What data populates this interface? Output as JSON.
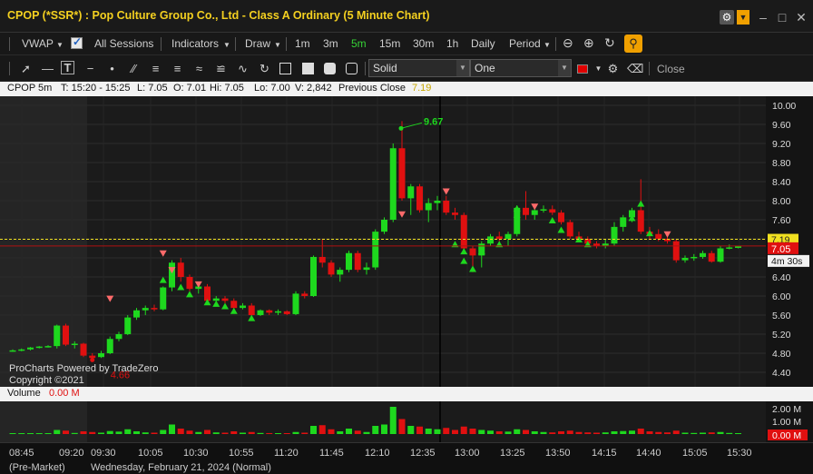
{
  "window": {
    "title": "CPOP (*SSR*) : Pop Culture Group Co., Ltd - Class A Ordinary (5 Minute Chart)"
  },
  "toolbar1": {
    "vwap": "VWAP",
    "all_sessions": "All Sessions",
    "indicators": "Indicators",
    "draw": "Draw",
    "intervals": [
      "1m",
      "3m",
      "5m",
      "15m",
      "30m",
      "1h",
      "Daily"
    ],
    "active_interval": "5m",
    "period": "Period"
  },
  "toolbar2": {
    "line_style": "Solid",
    "line_width": "One",
    "draw_color": "#e00000",
    "close": "Close"
  },
  "info": {
    "symbol": "CPOP 5m",
    "time": "T: 15:20 - 15:25",
    "last": "L: 7.05",
    "open": "O: 7.01",
    "high": "Hi: 7.05",
    "low": "Lo: 7.00",
    "volume": "V: 2,842",
    "prev_close_label": "Previous Close",
    "prev_close_value": "7.19"
  },
  "volume_panel": {
    "label": "Volume",
    "value": "0.00 M",
    "axis": [
      "2.00 M",
      "1.00 M",
      "0.00 M"
    ]
  },
  "watermark": {
    "line1": "ProCharts Powered by TradeZero",
    "line2": "Copyright ©2021"
  },
  "x_axis": {
    "ticks": [
      "08:45",
      "09:20",
      "09:30",
      "10:05",
      "10:30",
      "10:55",
      "11:20",
      "11:45",
      "12:10",
      "12:35",
      "13:00",
      "13:25",
      "13:50",
      "14:15",
      "14:40",
      "15:05",
      "15:30"
    ],
    "session": "(Pre-Market)",
    "date": "Wednesday, February 21, 2024 (Normal)"
  },
  "colors": {
    "up": "#1ed81e",
    "down": "#e01010",
    "prev_close_line": "#f0e020",
    "current_price_bg": "#e01010"
  },
  "chart_data": {
    "type": "candlestick",
    "ylim": [
      4.2,
      10.1
    ],
    "y_ticks": [
      "10.00",
      "9.60",
      "9.20",
      "8.80",
      "8.40",
      "8.00",
      "7.60",
      "7.20",
      "6.80",
      "6.40",
      "6.00",
      "5.60",
      "5.20",
      "4.80",
      "4.40"
    ],
    "previous_close": 7.19,
    "current_price": "7.05",
    "countdown": "4m 30s",
    "annotations": [
      {
        "label": "9.67",
        "value": 9.67
      },
      {
        "label": "4.66",
        "value": 4.66
      }
    ],
    "candles": [
      {
        "o": 4.85,
        "h": 4.88,
        "l": 4.83,
        "c": 4.86
      },
      {
        "o": 4.86,
        "h": 4.9,
        "l": 4.84,
        "c": 4.88
      },
      {
        "o": 4.88,
        "h": 4.93,
        "l": 4.86,
        "c": 4.92
      },
      {
        "o": 4.92,
        "h": 4.95,
        "l": 4.9,
        "c": 4.94
      },
      {
        "o": 4.94,
        "h": 4.97,
        "l": 4.92,
        "c": 4.95
      },
      {
        "o": 4.95,
        "h": 5.4,
        "l": 4.9,
        "c": 5.38
      },
      {
        "o": 5.38,
        "h": 5.42,
        "l": 4.95,
        "c": 4.98
      },
      {
        "o": 4.98,
        "h": 5.05,
        "l": 4.9,
        "c": 5.0
      },
      {
        "o": 5.0,
        "h": 5.02,
        "l": 4.72,
        "c": 4.75
      },
      {
        "o": 4.75,
        "h": 4.8,
        "l": 4.66,
        "c": 4.7
      },
      {
        "o": 4.72,
        "h": 4.85,
        "l": 4.7,
        "c": 4.8
      },
      {
        "o": 4.8,
        "h": 5.15,
        "l": 4.78,
        "c": 5.1
      },
      {
        "o": 5.1,
        "h": 5.25,
        "l": 5.05,
        "c": 5.2
      },
      {
        "o": 5.2,
        "h": 5.6,
        "l": 5.18,
        "c": 5.55
      },
      {
        "o": 5.55,
        "h": 5.75,
        "l": 5.5,
        "c": 5.7
      },
      {
        "o": 5.7,
        "h": 5.8,
        "l": 5.6,
        "c": 5.75
      },
      {
        "o": 5.75,
        "h": 5.82,
        "l": 5.68,
        "c": 5.72
      },
      {
        "o": 5.72,
        "h": 6.2,
        "l": 5.7,
        "c": 6.18
      },
      {
        "o": 6.18,
        "h": 6.75,
        "l": 6.1,
        "c": 6.7
      },
      {
        "o": 6.7,
        "h": 6.8,
        "l": 6.3,
        "c": 6.4
      },
      {
        "o": 6.4,
        "h": 6.45,
        "l": 6.1,
        "c": 6.15
      },
      {
        "o": 6.15,
        "h": 6.25,
        "l": 6.05,
        "c": 6.2
      },
      {
        "o": 6.2,
        "h": 6.25,
        "l": 5.85,
        "c": 5.9
      },
      {
        "o": 5.9,
        "h": 6.0,
        "l": 5.8,
        "c": 5.95
      },
      {
        "o": 5.95,
        "h": 6.0,
        "l": 5.85,
        "c": 5.9
      },
      {
        "o": 5.9,
        "h": 5.95,
        "l": 5.7,
        "c": 5.75
      },
      {
        "o": 5.75,
        "h": 5.85,
        "l": 5.72,
        "c": 5.8
      },
      {
        "o": 5.8,
        "h": 5.85,
        "l": 5.55,
        "c": 5.6
      },
      {
        "o": 5.6,
        "h": 5.72,
        "l": 5.58,
        "c": 5.7
      },
      {
        "o": 5.7,
        "h": 5.72,
        "l": 5.6,
        "c": 5.65
      },
      {
        "o": 5.65,
        "h": 5.72,
        "l": 5.6,
        "c": 5.68
      },
      {
        "o": 5.68,
        "h": 5.7,
        "l": 5.6,
        "c": 5.62
      },
      {
        "o": 5.62,
        "h": 6.1,
        "l": 5.6,
        "c": 6.05
      },
      {
        "o": 6.05,
        "h": 6.1,
        "l": 5.95,
        "c": 6.0
      },
      {
        "o": 6.0,
        "h": 6.85,
        "l": 5.98,
        "c": 6.82
      },
      {
        "o": 6.82,
        "h": 7.2,
        "l": 6.6,
        "c": 6.7
      },
      {
        "o": 6.7,
        "h": 6.75,
        "l": 6.4,
        "c": 6.45
      },
      {
        "o": 6.45,
        "h": 6.6,
        "l": 6.3,
        "c": 6.55
      },
      {
        "o": 6.55,
        "h": 6.95,
        "l": 6.5,
        "c": 6.9
      },
      {
        "o": 6.9,
        "h": 6.95,
        "l": 6.5,
        "c": 6.55
      },
      {
        "o": 6.55,
        "h": 6.7,
        "l": 6.45,
        "c": 6.6
      },
      {
        "o": 6.6,
        "h": 7.4,
        "l": 6.55,
        "c": 7.35
      },
      {
        "o": 7.35,
        "h": 7.65,
        "l": 7.3,
        "c": 7.6
      },
      {
        "o": 7.6,
        "h": 9.2,
        "l": 7.55,
        "c": 9.1
      },
      {
        "o": 9.1,
        "h": 9.67,
        "l": 8.0,
        "c": 8.05
      },
      {
        "o": 8.05,
        "h": 8.35,
        "l": 7.7,
        "c": 8.3
      },
      {
        "o": 8.3,
        "h": 8.35,
        "l": 7.75,
        "c": 7.8
      },
      {
        "o": 7.8,
        "h": 8.05,
        "l": 7.55,
        "c": 7.95
      },
      {
        "o": 7.95,
        "h": 8.1,
        "l": 7.8,
        "c": 8.0
      },
      {
        "o": 8.0,
        "h": 8.1,
        "l": 7.7,
        "c": 7.75
      },
      {
        "o": 7.75,
        "h": 7.85,
        "l": 7.6,
        "c": 7.7
      },
      {
        "o": 7.7,
        "h": 7.75,
        "l": 6.95,
        "c": 7.0
      },
      {
        "o": 7.0,
        "h": 7.05,
        "l": 6.5,
        "c": 6.85
      },
      {
        "o": 6.85,
        "h": 7.15,
        "l": 6.6,
        "c": 7.1
      },
      {
        "o": 7.1,
        "h": 7.3,
        "l": 7.05,
        "c": 7.25
      },
      {
        "o": 7.25,
        "h": 7.35,
        "l": 7.15,
        "c": 7.2
      },
      {
        "o": 7.2,
        "h": 7.35,
        "l": 7.05,
        "c": 7.3
      },
      {
        "o": 7.3,
        "h": 7.9,
        "l": 7.25,
        "c": 7.85
      },
      {
        "o": 7.85,
        "h": 8.2,
        "l": 7.6,
        "c": 7.7
      },
      {
        "o": 7.7,
        "h": 7.85,
        "l": 7.6,
        "c": 7.8
      },
      {
        "o": 7.8,
        "h": 7.9,
        "l": 7.75,
        "c": 7.82
      },
      {
        "o": 7.82,
        "h": 7.9,
        "l": 7.7,
        "c": 7.75
      },
      {
        "o": 7.75,
        "h": 7.8,
        "l": 7.5,
        "c": 7.55
      },
      {
        "o": 7.55,
        "h": 7.6,
        "l": 7.2,
        "c": 7.25
      },
      {
        "o": 7.25,
        "h": 7.35,
        "l": 7.15,
        "c": 7.2
      },
      {
        "o": 7.2,
        "h": 7.25,
        "l": 7.05,
        "c": 7.1
      },
      {
        "o": 7.1,
        "h": 7.15,
        "l": 7.0,
        "c": 7.05
      },
      {
        "o": 7.05,
        "h": 7.2,
        "l": 7.0,
        "c": 7.1
      },
      {
        "o": 7.1,
        "h": 7.55,
        "l": 7.05,
        "c": 7.45
      },
      {
        "o": 7.45,
        "h": 7.7,
        "l": 7.35,
        "c": 7.65
      },
      {
        "o": 7.65,
        "h": 7.85,
        "l": 7.55,
        "c": 7.8
      },
      {
        "o": 7.8,
        "h": 8.45,
        "l": 7.3,
        "c": 7.35
      },
      {
        "o": 7.35,
        "h": 7.45,
        "l": 7.2,
        "c": 7.3
      },
      {
        "o": 7.3,
        "h": 7.4,
        "l": 7.15,
        "c": 7.2
      },
      {
        "o": 7.2,
        "h": 7.25,
        "l": 7.1,
        "c": 7.15
      },
      {
        "o": 7.15,
        "h": 7.2,
        "l": 6.7,
        "c": 6.75
      },
      {
        "o": 6.75,
        "h": 6.85,
        "l": 6.7,
        "c": 6.8
      },
      {
        "o": 6.8,
        "h": 6.88,
        "l": 6.74,
        "c": 6.82
      },
      {
        "o": 6.82,
        "h": 6.95,
        "l": 6.78,
        "c": 6.9
      },
      {
        "o": 6.9,
        "h": 6.95,
        "l": 6.7,
        "c": 6.72
      },
      {
        "o": 6.72,
        "h": 7.05,
        "l": 6.7,
        "c": 7.0
      },
      {
        "o": 7.0,
        "h": 7.08,
        "l": 6.98,
        "c": 7.02
      },
      {
        "o": 7.01,
        "h": 7.05,
        "l": 7.0,
        "c": 7.05
      }
    ],
    "volume": [
      0.05,
      0.06,
      0.05,
      0.04,
      0.05,
      0.3,
      0.25,
      0.08,
      0.2,
      0.15,
      0.1,
      0.22,
      0.18,
      0.35,
      0.2,
      0.12,
      0.1,
      0.3,
      0.7,
      0.4,
      0.25,
      0.15,
      0.3,
      0.12,
      0.1,
      0.2,
      0.1,
      0.15,
      0.08,
      0.07,
      0.06,
      0.06,
      0.15,
      0.1,
      0.6,
      0.65,
      0.35,
      0.2,
      0.4,
      0.25,
      0.15,
      0.6,
      0.7,
      2.0,
      1.1,
      0.6,
      0.55,
      0.4,
      0.35,
      0.45,
      0.3,
      0.55,
      0.4,
      0.3,
      0.25,
      0.2,
      0.18,
      0.35,
      0.3,
      0.2,
      0.15,
      0.12,
      0.2,
      0.25,
      0.15,
      0.12,
      0.1,
      0.12,
      0.2,
      0.22,
      0.25,
      0.4,
      0.2,
      0.15,
      0.12,
      0.25,
      0.1,
      0.08,
      0.1,
      0.12,
      0.15,
      0.08,
      0.05
    ]
  }
}
